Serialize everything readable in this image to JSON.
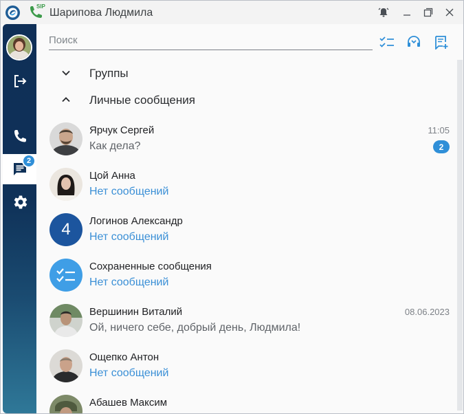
{
  "window": {
    "title": "Шарипова Людмила",
    "sip_badge": "SIP"
  },
  "sidebar": {
    "chat_badge": "2",
    "items": [
      {
        "name": "logout",
        "icon": "logout-icon"
      },
      {
        "name": "calls",
        "icon": "phone-icon"
      },
      {
        "name": "chats",
        "icon": "chat-icon",
        "active": true
      },
      {
        "name": "settings",
        "icon": "gear-icon"
      }
    ]
  },
  "search": {
    "placeholder": "Поиск",
    "value": ""
  },
  "sections": {
    "groups": "Группы",
    "personal": "Личные сообщения"
  },
  "chats": [
    {
      "name": "Ярчук Сергей",
      "message": "Как дела?",
      "time": "11:05",
      "unread": "2",
      "avatar": "photo"
    },
    {
      "name": "Цой Анна",
      "message": "Нет сообщений",
      "time": "",
      "unread": "",
      "avatar": "photo"
    },
    {
      "name": "Логинов Александр",
      "message": "Нет сообщений",
      "time": "",
      "unread": "",
      "avatar": "4"
    },
    {
      "name": "Сохраненные сообщения",
      "message": "Нет сообщений",
      "time": "",
      "unread": "",
      "avatar": "checklist-icon"
    },
    {
      "name": "Вершинин Виталий",
      "message": "Ой, ничего себе, добрый день, Людмила!",
      "time": "08.06.2023",
      "unread": "",
      "avatar": "photo"
    },
    {
      "name": "Ощепко Антон",
      "message": "Нет сообщений",
      "time": "",
      "unread": "",
      "avatar": "photo"
    },
    {
      "name": "Абашев Максим",
      "message": "",
      "time": "",
      "unread": "",
      "avatar": "photo"
    }
  ],
  "colors": {
    "accent": "#2f8fd8",
    "sidebar_top": "#0f2f57",
    "sidebar_bottom": "#2f7898",
    "empty_message": "#3a8fd6"
  }
}
